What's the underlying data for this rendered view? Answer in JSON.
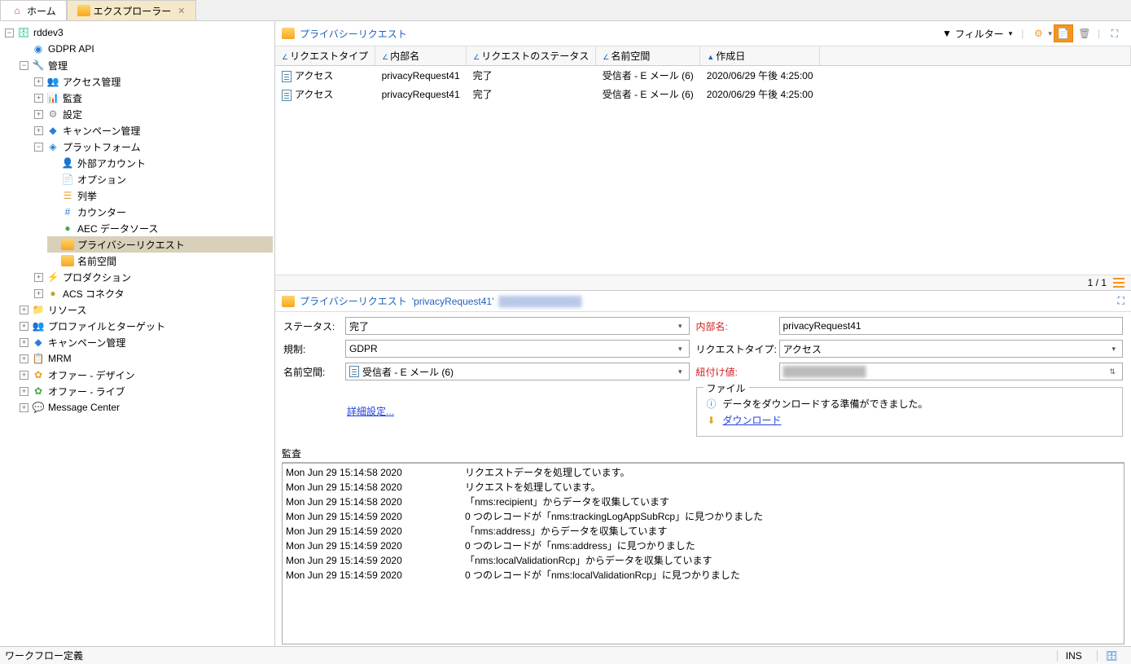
{
  "tabs": {
    "home": "ホーム",
    "explorer": "エクスプローラー"
  },
  "tree": {
    "root": "rddev3",
    "gdpr_api": "GDPR API",
    "admin": "管理",
    "access_mgmt": "アクセス管理",
    "audit": "監査",
    "settings": "設定",
    "campaign_mgmt": "キャンペーン管理",
    "platform": "プラットフォーム",
    "ext_account": "外部アカウント",
    "option": "オプション",
    "enum": "列挙",
    "counter": "カウンター",
    "aec": "AEC データソース",
    "privacy_req": "プライバシーリクエスト",
    "namespace": "名前空間",
    "production": "プロダクション",
    "acs": "ACS コネクタ",
    "resource": "リソース",
    "profile_target": "プロファイルとターゲット",
    "campaign_mgmt2": "キャンペーン管理",
    "mrm": "MRM",
    "offer_design": "オファー - デザイン",
    "offer_live": "オファー - ライブ",
    "msg_center": "Message Center"
  },
  "list": {
    "title": "プライバシーリクエスト",
    "filter": "フィルター",
    "cols": {
      "type": "リクエストタイプ",
      "internal": "内部名",
      "status": "リクエストのステータス",
      "ns": "名前空間",
      "created": "作成日"
    },
    "rows": [
      {
        "type": "アクセス",
        "internal": "privacyRequest41",
        "status": "完了",
        "ns": "受信者 - E メール (6)",
        "created": "2020/06/29 午後 4:25:00"
      },
      {
        "type": "アクセス",
        "internal": "privacyRequest41",
        "status": "完了",
        "ns": "受信者 - E メール (6)",
        "created": "2020/06/29 午後 4:25:00"
      }
    ],
    "pager": "1 / 1"
  },
  "detail": {
    "title_prefix": "プライバシーリクエスト",
    "title_name": "'privacyRequest41'",
    "labels": {
      "status": "ステータス:",
      "regulation": "規制:",
      "ns": "名前空間:",
      "internal": "内部名:",
      "reqtype": "リクエストタイプ:",
      "recon": "紐付け値:",
      "advanced": "詳細設定...",
      "file": "ファイル",
      "file_ready": "データをダウンロードする準備ができました。",
      "download": "ダウンロード"
    },
    "values": {
      "status": "完了",
      "regulation": "GDPR",
      "ns": "受信者 - E メール (6)",
      "internal": "privacyRequest41",
      "reqtype": "アクセス"
    }
  },
  "audit": {
    "label": "監査",
    "rows": [
      {
        "ts": "Mon Jun 29 15:14:58 2020",
        "msg": "リクエストデータを処理しています。"
      },
      {
        "ts": "Mon Jun 29 15:14:58 2020",
        "msg": "リクエストを処理しています。"
      },
      {
        "ts": "Mon Jun 29 15:14:58 2020",
        "msg": "「nms:recipient」からデータを収集しています"
      },
      {
        "ts": "Mon Jun 29 15:14:59 2020",
        "msg": "0 つのレコードが「nms:trackingLogAppSubRcp」に見つかりました"
      },
      {
        "ts": "Mon Jun 29 15:14:59 2020",
        "msg": "「nms:address」からデータを収集しています"
      },
      {
        "ts": "Mon Jun 29 15:14:59 2020",
        "msg": "0 つのレコードが「nms:address」に見つかりました"
      },
      {
        "ts": "Mon Jun 29 15:14:59 2020",
        "msg": "「nms:localValidationRcp」からデータを収集しています"
      },
      {
        "ts": "Mon Jun 29 15:14:59 2020",
        "msg": "0 つのレコードが「nms:localValidationRcp」に見つかりました"
      }
    ]
  },
  "status": {
    "left": "ワークフロー定義",
    "ins": "INS"
  }
}
